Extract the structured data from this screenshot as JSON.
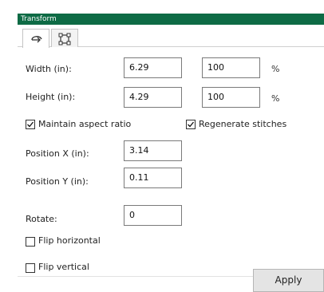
{
  "panel": {
    "title": "Transform"
  },
  "tabs": [
    {
      "icon": "rotate-arrow-icon",
      "active": true
    },
    {
      "icon": "bounding-box-icon",
      "active": false
    }
  ],
  "width": {
    "label": "Width (in):",
    "value": "6.29",
    "percent": "100",
    "unit": "%"
  },
  "height": {
    "label": "Height (in):",
    "value": "4.29",
    "percent": "100",
    "unit": "%"
  },
  "maintain_aspect": {
    "label": "Maintain aspect ratio",
    "checked": true
  },
  "regenerate": {
    "label": "Regenerate stitches",
    "checked": true
  },
  "position_x": {
    "label": "Position X (in):",
    "value": "3.14"
  },
  "position_y": {
    "label": "Position Y (in):",
    "value": "0.11"
  },
  "rotate": {
    "label": "Rotate:",
    "value": "0"
  },
  "flip_horizontal": {
    "label": "Flip horizontal",
    "checked": false
  },
  "flip_vertical": {
    "label": "Flip vertical",
    "checked": false
  },
  "apply_label": "Apply",
  "colors": {
    "titlebar": "#0e6b45"
  }
}
